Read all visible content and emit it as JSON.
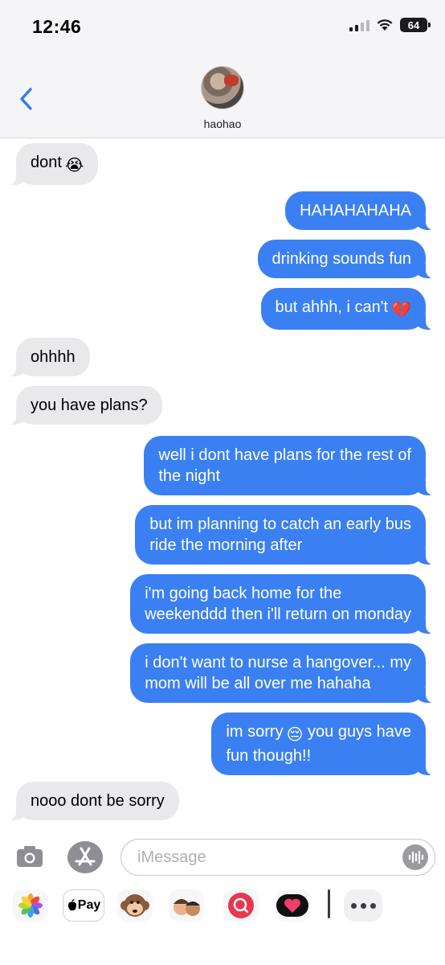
{
  "status_bar": {
    "time": "12:46",
    "battery": "64"
  },
  "header": {
    "contact_name": "haohao"
  },
  "messages": [
    {
      "side": "in",
      "lines": [
        "dont"
      ],
      "emoji": "😭"
    },
    {
      "side": "out",
      "lines": [
        "HAHAHAHAHA"
      ]
    },
    {
      "side": "out",
      "lines": [
        "drinking sounds fun"
      ]
    },
    {
      "side": "out",
      "lines": [
        "but ahhh, i can't"
      ],
      "emoji": "💔"
    },
    {
      "side": "in",
      "lines": [
        "ohhhh"
      ]
    },
    {
      "side": "in",
      "lines": [
        "you have plans?"
      ]
    },
    {
      "side": "out",
      "lines": [
        "well i dont have plans for the rest of",
        "the night"
      ]
    },
    {
      "side": "out",
      "lines": [
        "but im planning to catch an early bus",
        "ride the morning after"
      ]
    },
    {
      "side": "out",
      "lines": [
        "i'm going back home for the",
        "weekenddd then i'll return on monday"
      ]
    },
    {
      "side": "out",
      "lines": [
        "i don't want to nurse a hangover... my",
        "mom will be all over me hahaha"
      ]
    },
    {
      "side": "out",
      "lines": [
        "im sorry",
        "fun though!!"
      ],
      "line1_after_emoji": "you guys have",
      "emoji": "😔"
    },
    {
      "side": "in",
      "lines": [
        "nooo dont be sorry"
      ]
    }
  ],
  "compose": {
    "placeholder": "iMessage"
  },
  "app_drawer": {
    "apple_pay_label": "Pay",
    "icons": [
      "photos-icon",
      "apple-pay-icon",
      "monkey-emoji-icon",
      "memoji-icon",
      "image-search-icon",
      "digital-touch-heart-icon",
      "more-icon"
    ]
  },
  "colors": {
    "outgoing_bubble": "#3b80f2",
    "incoming_bubble": "#e9e9eb",
    "accent": "#2f7cf6"
  }
}
